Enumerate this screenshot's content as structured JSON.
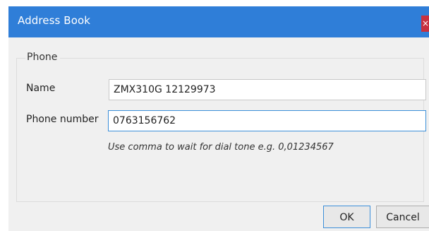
{
  "window": {
    "title": "Address Book",
    "close_glyph": "×"
  },
  "group": {
    "title": "Phone"
  },
  "fields": {
    "name_label": "Name",
    "name_value": "ZMX310G 12129973",
    "phone_label": "Phone number",
    "phone_value": "0763156762"
  },
  "hint": "Use comma to wait for dial tone e.g. 0,01234567",
  "buttons": {
    "ok": "OK",
    "cancel": "Cancel"
  },
  "colors": {
    "titlebar": "#2f7ed8",
    "close": "#c7313f",
    "focus_border": "#3c8fd9"
  }
}
